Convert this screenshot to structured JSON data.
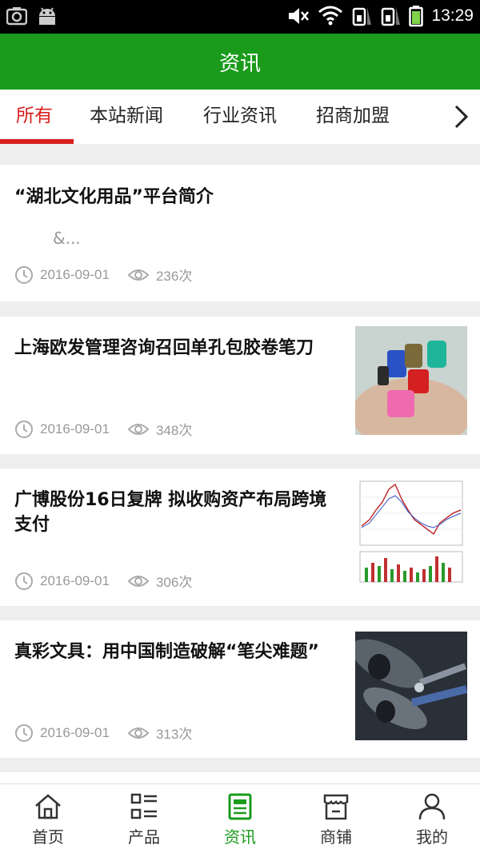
{
  "status_bar": {
    "time": "13:29"
  },
  "header": {
    "title": "资讯"
  },
  "tabs": [
    {
      "label": "所有",
      "active": true
    },
    {
      "label": "本站新闻"
    },
    {
      "label": "行业资讯"
    },
    {
      "label": "招商加盟"
    }
  ],
  "articles": [
    {
      "title": "“湖北文化用品”平台简介",
      "excerpt": "&...",
      "date": "2016-09-01",
      "views": "236次"
    },
    {
      "title": "上海欧发管理咨询召回单孔包胶卷笔刀",
      "date": "2016-09-01",
      "views": "348次",
      "thumb": "sharpener-photo"
    },
    {
      "title": "广博股份16日复牌 拟收购资产布局跨境支付",
      "date": "2016-09-01",
      "views": "306次",
      "thumb": "stock-chart-photo"
    },
    {
      "title": "真彩文具：用中国制造破解“笔尖难题”",
      "date": "2016-09-01",
      "views": "313次",
      "thumb": "pen-machine-photo"
    }
  ],
  "bottom_nav": [
    {
      "label": "首页",
      "icon": "home-icon"
    },
    {
      "label": "产品",
      "icon": "product-list-icon"
    },
    {
      "label": "资讯",
      "icon": "news-icon",
      "active": true
    },
    {
      "label": "商铺",
      "icon": "shop-icon"
    },
    {
      "label": "我的",
      "icon": "user-icon"
    }
  ],
  "colors": {
    "brand_green": "#1a9b1c",
    "active_red": "#d8201d"
  }
}
